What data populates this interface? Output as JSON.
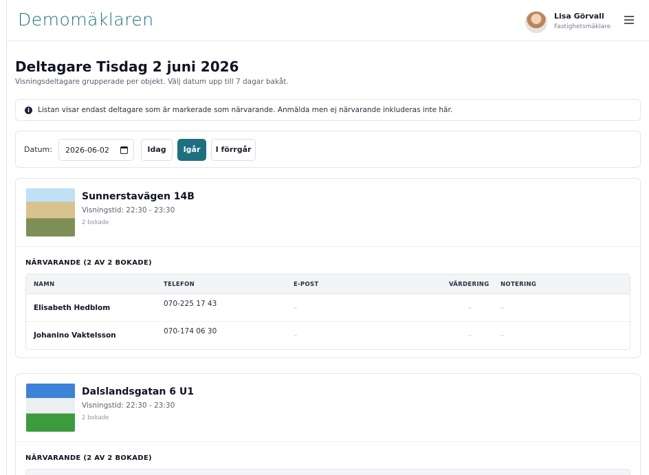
{
  "header": {
    "brand": "Demomäklaren",
    "user_name": "Lisa Görvall",
    "user_role": "Fastighetsmäklare"
  },
  "page": {
    "title": "Deltagare Tisdag 2 juni 2026",
    "subtitle": "Visningsdeltagare grupperade per objekt. Välj datum upp till 7 dagar bakåt."
  },
  "info": {
    "text": "Listan visar endast deltagare som är markerade som närvarande. Anmälda men ej närvarande inkluderas inte här."
  },
  "date_filter": {
    "label": "Datum:",
    "value": "2026-06-02",
    "buttons": [
      "Idag",
      "Igår",
      "I förrgår"
    ],
    "active": "Igår"
  },
  "table_headers": {
    "name": "NAMN",
    "phone": "TELEFON",
    "email": "E-POST",
    "valuation": "VÄRDERING",
    "note": "NOTERING"
  },
  "listings": [
    {
      "address": "Sunnerstavägen 14B",
      "time": "Visningstid: 22:30 - 23:30",
      "booked": "2 bokade",
      "section": "NÄRVARANDE (2 AV 2 BOKADE)",
      "attendees": [
        {
          "name": "Elisabeth Hedblom",
          "phone": "070-225 17 43",
          "email": "–",
          "valuation": "–",
          "note": "–"
        },
        {
          "name": "Johanino Vaktelsson",
          "phone": "070-174 06 30",
          "email": "–",
          "valuation": "–",
          "note": "–"
        }
      ]
    },
    {
      "address": "Dalslandsgatan 6 U1",
      "time": "Visningstid: 22:30 - 23:30",
      "booked": "2 bokade",
      "section": "NÄRVARANDE (2 AV 2 BOKADE)"
    }
  ]
}
